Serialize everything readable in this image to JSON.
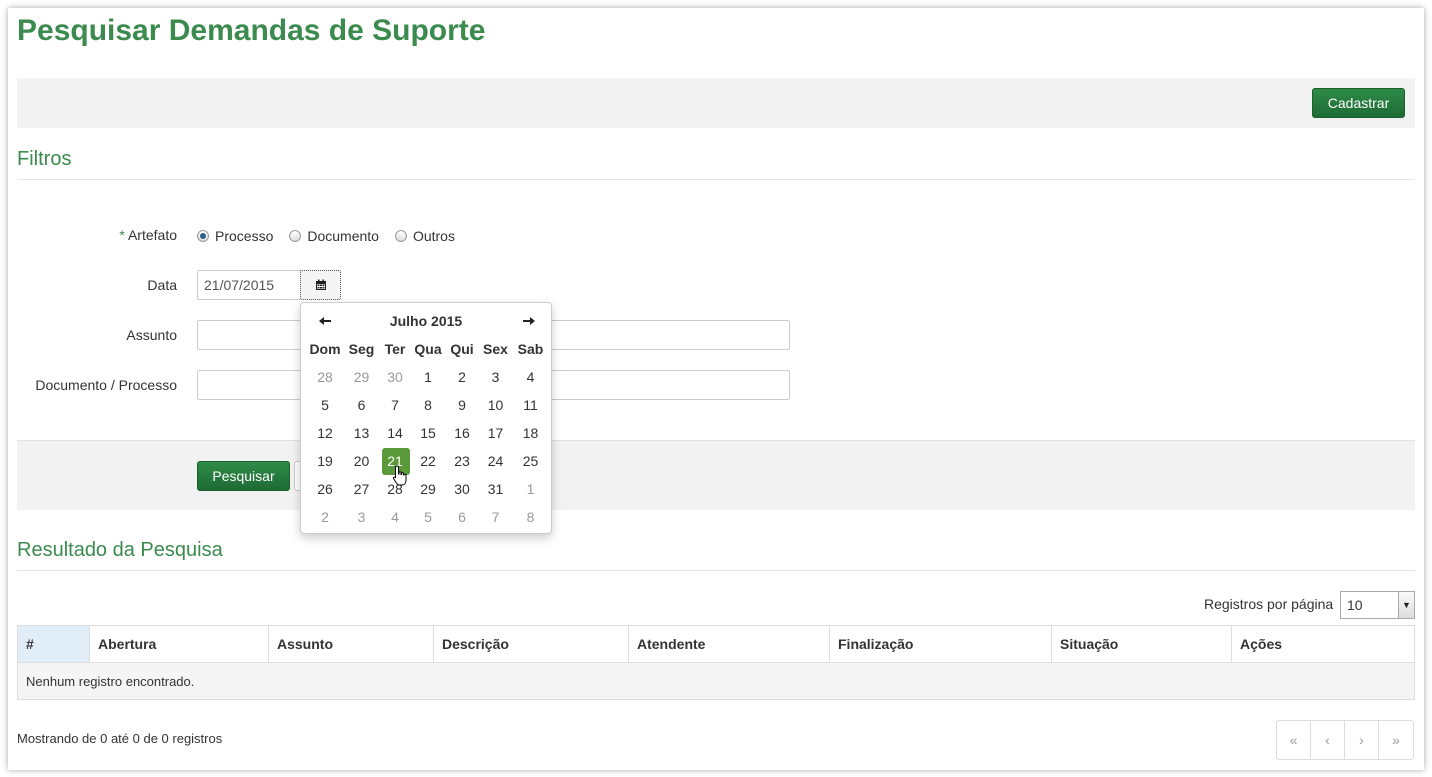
{
  "page": {
    "title": "Pesquisar Demandas de Suporte"
  },
  "toolbar": {
    "cadastrar_label": "Cadastrar"
  },
  "filters": {
    "title": "Filtros",
    "artefato": {
      "required_mark": "*",
      "label": "Artefato",
      "options": [
        "Processo",
        "Documento",
        "Outros"
      ],
      "selected": "Processo"
    },
    "data": {
      "label": "Data",
      "value": "21/07/2015",
      "icon": "calendar-icon"
    },
    "assunto": {
      "label": "Assunto",
      "value": ""
    },
    "documento": {
      "label": "Documento / Processo",
      "value": ""
    },
    "pesquisar_label": "Pesquisar"
  },
  "datepicker": {
    "title": "Julho 2015",
    "prev": "🡐",
    "next": "🡒",
    "weekdays": [
      "Dom",
      "Seg",
      "Ter",
      "Qua",
      "Qui",
      "Sex",
      "Sab"
    ],
    "weeks": [
      [
        "28",
        "29",
        "30",
        "1",
        "2",
        "3",
        "4"
      ],
      [
        "5",
        "6",
        "7",
        "8",
        "9",
        "10",
        "11"
      ],
      [
        "12",
        "13",
        "14",
        "15",
        "16",
        "17",
        "18"
      ],
      [
        "19",
        "20",
        "21",
        "22",
        "23",
        "24",
        "25"
      ],
      [
        "26",
        "27",
        "28",
        "29",
        "30",
        "31",
        "1"
      ],
      [
        "2",
        "3",
        "4",
        "5",
        "6",
        "7",
        "8"
      ]
    ],
    "selected": "21"
  },
  "results": {
    "title": "Resultado da Pesquisa",
    "rpp_label": "Registros por página",
    "rpp_value": "10",
    "columns": [
      "#",
      "Abertura",
      "Assunto",
      "Descrição",
      "Atendente",
      "Finalização",
      "Situação",
      "Ações"
    ],
    "empty_message": "Nenhum registro encontrado.",
    "info": "Mostrando de 0 até 0 de 0 registros",
    "pager": [
      "«",
      "‹",
      "›",
      "»"
    ]
  },
  "colors": {
    "accent": "#3b8a4e",
    "button": "#1e6b35",
    "selected_day": "#5a9a3a"
  }
}
